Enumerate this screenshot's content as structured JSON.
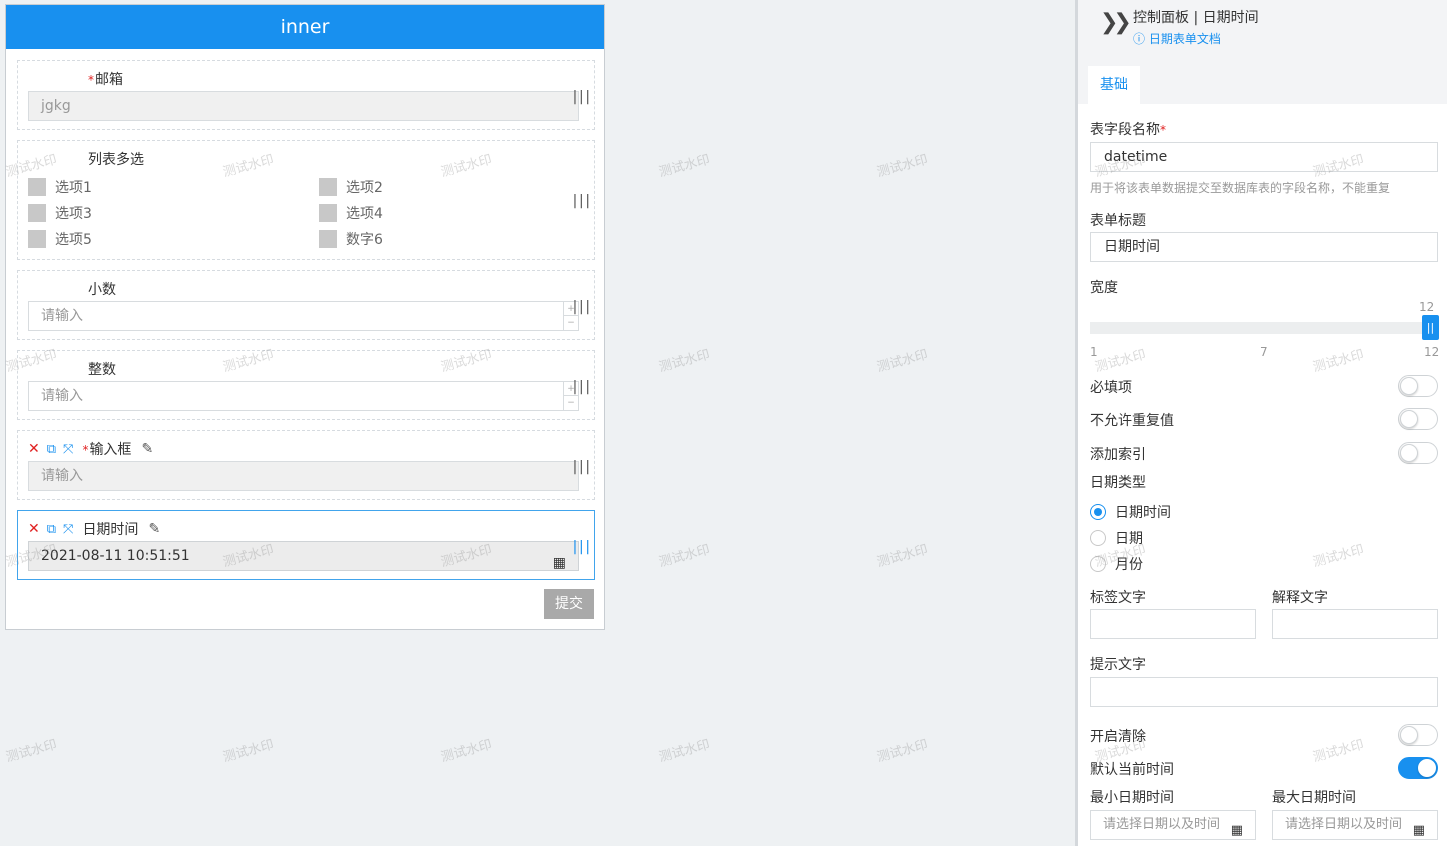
{
  "form": {
    "title": "inner",
    "required_mark": "*",
    "drag_handle": "|||",
    "email": {
      "label": "邮箱",
      "value": "jgkg"
    },
    "multi_list": {
      "label": "列表多选",
      "options": [
        "选项1",
        "选项2",
        "选项3",
        "选项4",
        "选项5",
        "数字6"
      ]
    },
    "decimal": {
      "label": "小数",
      "placeholder": "请输入"
    },
    "integer": {
      "label": "整数",
      "placeholder": "请输入"
    },
    "text_input": {
      "label": "输入框",
      "placeholder": "请输入"
    },
    "datetime": {
      "label": "日期时间",
      "value": "2021-08-11 10:51:51"
    },
    "stepper_up": "+",
    "stepper_down": "−",
    "submit_label": "提交"
  },
  "panel": {
    "title": "控制面板 | 日期时间",
    "doc_link": "日期表单文档",
    "tab": "基础",
    "field_name": {
      "label": "表字段名称",
      "value": "datetime",
      "hint": "用于将该表单数据提交至数据库表的字段名称，不能重复"
    },
    "form_title": {
      "label": "表单标题",
      "value": "日期时间"
    },
    "width": {
      "label": "宽度",
      "value": "12",
      "min": "1",
      "mid": "7",
      "max": "12",
      "level": 12
    },
    "toggles": [
      {
        "label": "必填项",
        "on": false
      },
      {
        "label": "不允许重复值",
        "on": false
      },
      {
        "label": "添加索引",
        "on": false
      }
    ],
    "date_type": {
      "label": "日期类型",
      "options": [
        "日期时间",
        "日期",
        "月份"
      ],
      "selected": "日期时间"
    },
    "tag_text": {
      "label": "标签文字",
      "value": ""
    },
    "explain_text": {
      "label": "解释文字",
      "value": ""
    },
    "prompt_text": {
      "label": "提示文字",
      "value": ""
    },
    "clearable": {
      "label": "开启清除",
      "on": false
    },
    "default_now": {
      "label": "默认当前时间",
      "on": true
    },
    "min_date": {
      "label": "最小日期时间",
      "placeholder": "请选择日期以及时间"
    },
    "max_date": {
      "label": "最大日期时间",
      "placeholder": "请选择日期以及时间"
    }
  },
  "watermark": "测试水印",
  "accent_color": "#1890ef"
}
